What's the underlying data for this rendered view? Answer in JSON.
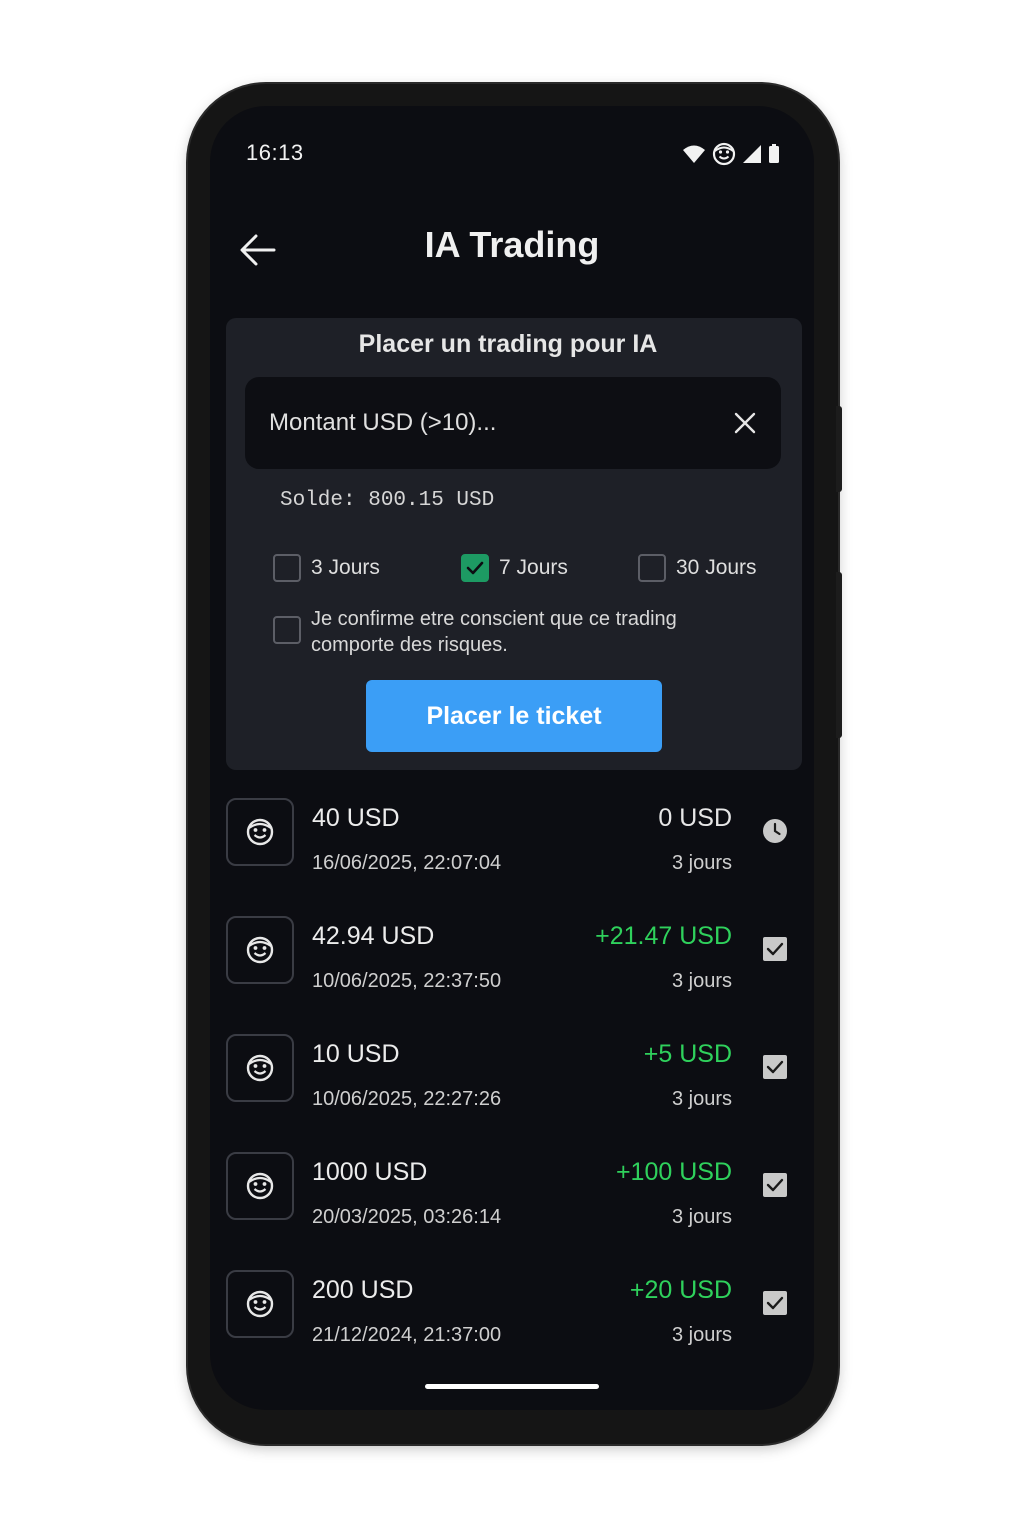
{
  "status_bar": {
    "time": "16:13"
  },
  "header": {
    "title": "IA Trading"
  },
  "form": {
    "title": "Placer un trading pour IA",
    "amount_placeholder": "Montant USD (>10)...",
    "amount_value": "",
    "balance": "Solde: 800.15 USD",
    "durations": [
      {
        "label": "3 Jours",
        "checked": false
      },
      {
        "label": "7 Jours",
        "checked": true
      },
      {
        "label": "30 Jours",
        "checked": false
      }
    ],
    "confirm_label": "Je confirme etre conscient que ce trading comporte des risques.",
    "confirm_checked": false,
    "submit_label": "Placer le ticket"
  },
  "colors": {
    "accent": "#3b9ef6",
    "profit": "#2fd15c",
    "checked": "#1d9a63",
    "pending": "#c9c9c9"
  },
  "trades": [
    {
      "amount": "40 USD",
      "date": "16/06/2025, 22:07:04",
      "profit": "0 USD",
      "duration": "3 jours",
      "status": "clock-icon"
    },
    {
      "amount": "42.94 USD",
      "date": "10/06/2025, 22:37:50",
      "profit": "+21.47 USD",
      "duration": "3 jours",
      "status": "checkbox-checked-icon"
    },
    {
      "amount": "10 USD",
      "date": "10/06/2025, 22:27:26",
      "profit": "+5 USD",
      "duration": "3 jours",
      "status": "checkbox-checked-icon"
    },
    {
      "amount": "1000 USD",
      "date": "20/03/2025, 03:26:14",
      "profit": "+100 USD",
      "duration": "3 jours",
      "status": "checkbox-checked-icon"
    },
    {
      "amount": "200 USD",
      "date": "21/12/2024, 21:37:00",
      "profit": "+20 USD",
      "duration": "3 jours",
      "status": "checkbox-checked-icon"
    }
  ]
}
